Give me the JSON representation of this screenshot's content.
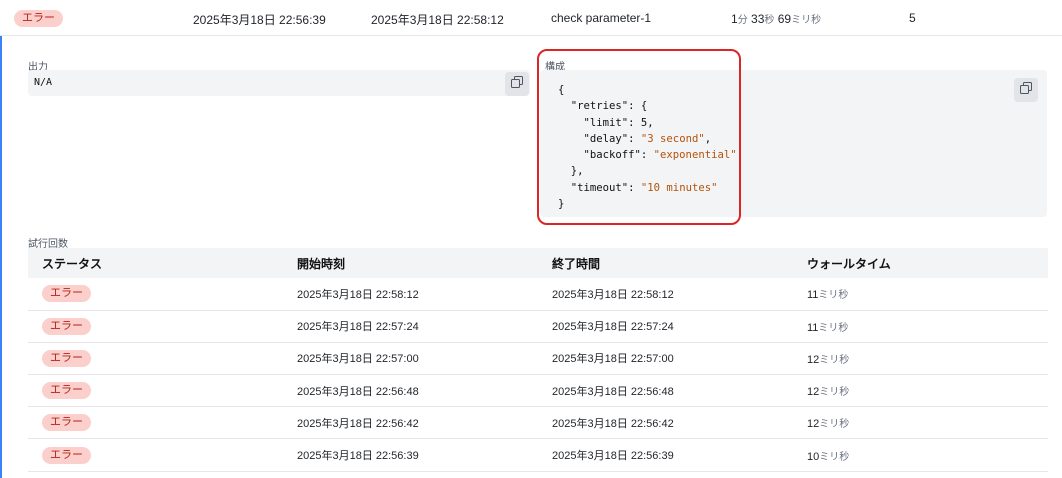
{
  "execution": {
    "status": "エラー",
    "start_time": "2025年3月18日 22:56:39",
    "end_time": "2025年3月18日 22:58:12",
    "name": "check parameter-1",
    "wall_time": {
      "min_value": "1",
      "min_unit": "分",
      "sec_value": "33",
      "sec_unit": "秒",
      "ms_value": "69",
      "ms_unit": "ミリ秒"
    },
    "attempt_count": "5"
  },
  "output": {
    "label": "出力",
    "value": "N/A"
  },
  "config": {
    "label": "構成",
    "line1": "{",
    "line2": "  \"retries\": {",
    "line3_key": "    \"limit\": ",
    "line3_val": "5,",
    "line4_key": "    \"delay\": ",
    "line4_val": "\"3 second\"",
    "line4_tail": ",",
    "line5_key": "    \"backoff\": ",
    "line5_val": "\"exponential\"",
    "line6": "  },",
    "line7_key": "  \"timeout\": ",
    "line7_val": "\"10 minutes\"",
    "line8": "}"
  },
  "attempts": {
    "label": "試行回数",
    "headers": [
      "ステータス",
      "開始時刻",
      "終了時間",
      "ウォールタイム"
    ],
    "rows": [
      {
        "status": "エラー",
        "start": "2025年3月18日 22:58:12",
        "end": "2025年3月18日 22:58:12",
        "wall": "11",
        "unit": "ミリ秒"
      },
      {
        "status": "エラー",
        "start": "2025年3月18日 22:57:24",
        "end": "2025年3月18日 22:57:24",
        "wall": "11",
        "unit": "ミリ秒"
      },
      {
        "status": "エラー",
        "start": "2025年3月18日 22:57:00",
        "end": "2025年3月18日 22:57:00",
        "wall": "12",
        "unit": "ミリ秒"
      },
      {
        "status": "エラー",
        "start": "2025年3月18日 22:56:48",
        "end": "2025年3月18日 22:56:48",
        "wall": "12",
        "unit": "ミリ秒"
      },
      {
        "status": "エラー",
        "start": "2025年3月18日 22:56:42",
        "end": "2025年3月18日 22:56:42",
        "wall": "12",
        "unit": "ミリ秒"
      },
      {
        "status": "エラー",
        "start": "2025年3月18日 22:56:39",
        "end": "2025年3月18日 22:56:39",
        "wall": "10",
        "unit": "ミリ秒"
      }
    ]
  },
  "icons": {
    "copy": "copy-icon"
  },
  "colors": {
    "error_badge_bg": "#fbd0cc",
    "error_badge_text": "#b42318",
    "highlight": "#dc2626",
    "string_value": "#b45309",
    "accent": "#3b82f6"
  }
}
